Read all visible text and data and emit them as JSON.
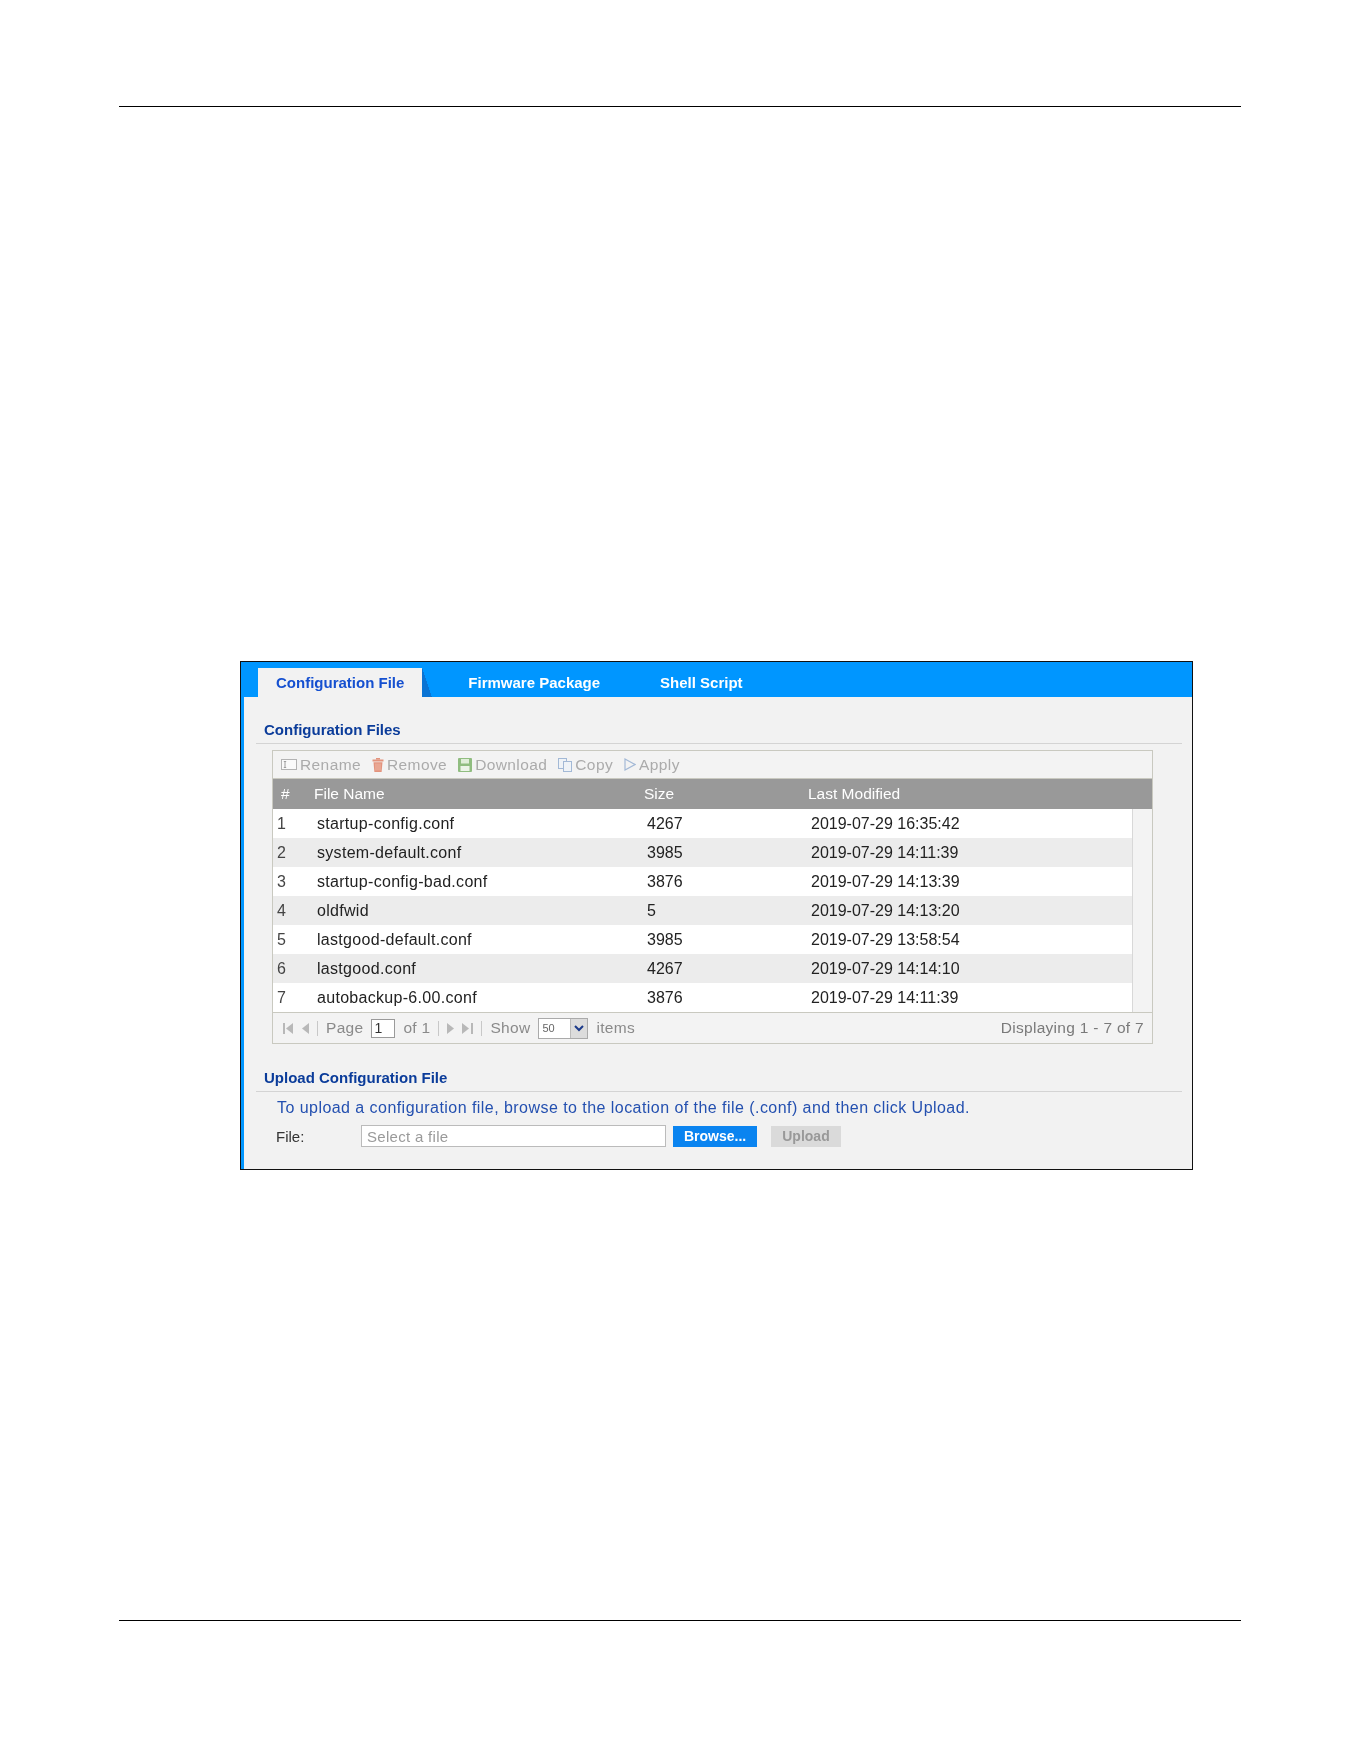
{
  "tabs": [
    {
      "label": "Configuration File",
      "selected": true
    },
    {
      "label": "Firmware Package",
      "selected": false
    },
    {
      "label": "Shell Script",
      "selected": false
    }
  ],
  "files": {
    "title": "Configuration Files",
    "toolbar": [
      {
        "kind": "rename",
        "label": "Rename",
        "disabled": true
      },
      {
        "kind": "remove",
        "label": "Remove",
        "disabled": true
      },
      {
        "kind": "download",
        "label": "Download",
        "disabled": true
      },
      {
        "kind": "copy",
        "label": "Copy",
        "disabled": true
      },
      {
        "kind": "apply",
        "label": "Apply",
        "disabled": true
      }
    ],
    "table": {
      "columns": [
        "#",
        "File Name",
        "Size",
        "Last Modified"
      ],
      "rows": [
        [
          "1",
          "startup-config.conf",
          "4267",
          "2019-07-29 16:35:42"
        ],
        [
          "2",
          "system-default.conf",
          "3985",
          "2019-07-29 14:11:39"
        ],
        [
          "3",
          "startup-config-bad.conf",
          "3876",
          "2019-07-29 14:13:39"
        ],
        [
          "4",
          "oldfwid",
          "5",
          "2019-07-29 14:13:20"
        ],
        [
          "5",
          "lastgood-default.conf",
          "3985",
          "2019-07-29 13:58:54"
        ],
        [
          "6",
          "lastgood.conf",
          "4267",
          "2019-07-29 14:14:10"
        ],
        [
          "7",
          "autobackup-6.00.conf",
          "3876",
          "2019-07-29 14:11:39"
        ]
      ]
    },
    "pager": {
      "nav_back": [
        {
          "kind": "first",
          "disabled": true
        },
        {
          "kind": "prev",
          "disabled": true
        }
      ],
      "page_label": "Page",
      "page_value": "1",
      "page_total": "of 1",
      "nav_forward": [
        {
          "kind": "next",
          "disabled": true
        },
        {
          "kind": "last",
          "disabled": true
        }
      ],
      "show_label": "Show",
      "page_size": "50",
      "items_label": "items",
      "summary": "Displaying 1 - 7 of 7"
    }
  },
  "upload": {
    "title": "Upload Configuration File",
    "instruction": "To upload a configuration file, browse to the location of the file (.conf) and then click Upload.",
    "file_label": "File:",
    "file_field": {
      "placeholder": "Select a file"
    },
    "buttons": [
      {
        "label": "Browse...",
        "disabled": false
      },
      {
        "label": "Upload",
        "disabled": true
      }
    ]
  }
}
